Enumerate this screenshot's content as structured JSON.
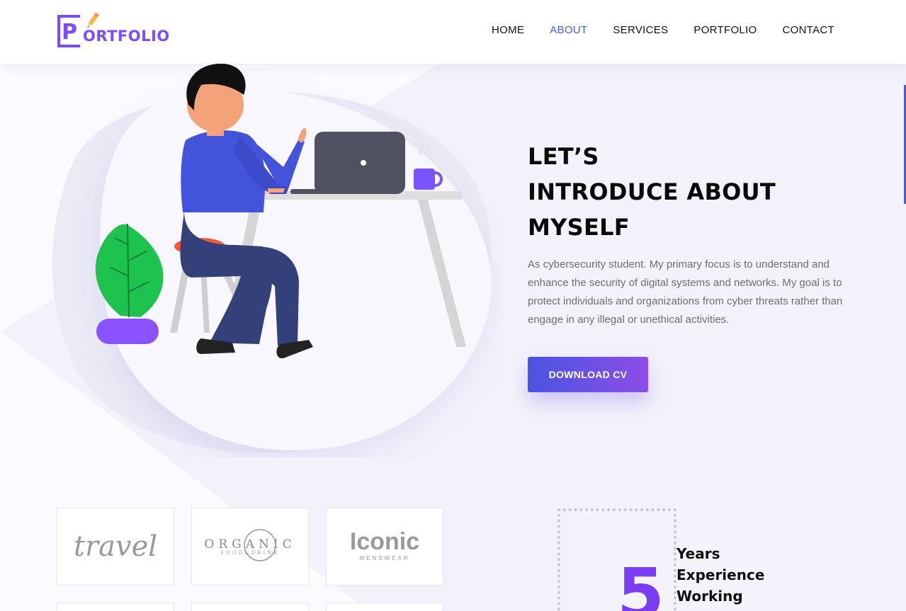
{
  "logo": {
    "initial": "P",
    "rest": "ORTFOLIO"
  },
  "nav": {
    "items": [
      {
        "label": "HOME"
      },
      {
        "label": "ABOUT"
      },
      {
        "label": "SERVICES"
      },
      {
        "label": "PORTFOLIO"
      },
      {
        "label": "CONTACT"
      }
    ],
    "active": "ABOUT"
  },
  "hero": {
    "title_lines": [
      "LET’S",
      "INTRODUCE ABOUT",
      "MYSELF"
    ],
    "description": "As cybersecurity student. My primary focus is to understand and enhance the security of digital systems and networks. My goal is to protect individuals and organizations from cyber threats rather than engage in any illegal or unethical activities.",
    "button_label": "DOWNLOAD CV"
  },
  "brands": [
    {
      "name": "travel"
    },
    {
      "name": "ORGANIC",
      "tagline": "FOOD&DRINK"
    },
    {
      "name": "Iconic",
      "tagline": "MENSWEAR"
    }
  ],
  "experience": {
    "number": "5",
    "label_lines": [
      "Years",
      "Experience",
      "Working"
    ]
  },
  "colors": {
    "accent": "#4a5bdc",
    "brand": "#7c4dff",
    "button_start": "#4a55e0",
    "button_end": "#8d4de8",
    "number": "#7a3df2"
  }
}
